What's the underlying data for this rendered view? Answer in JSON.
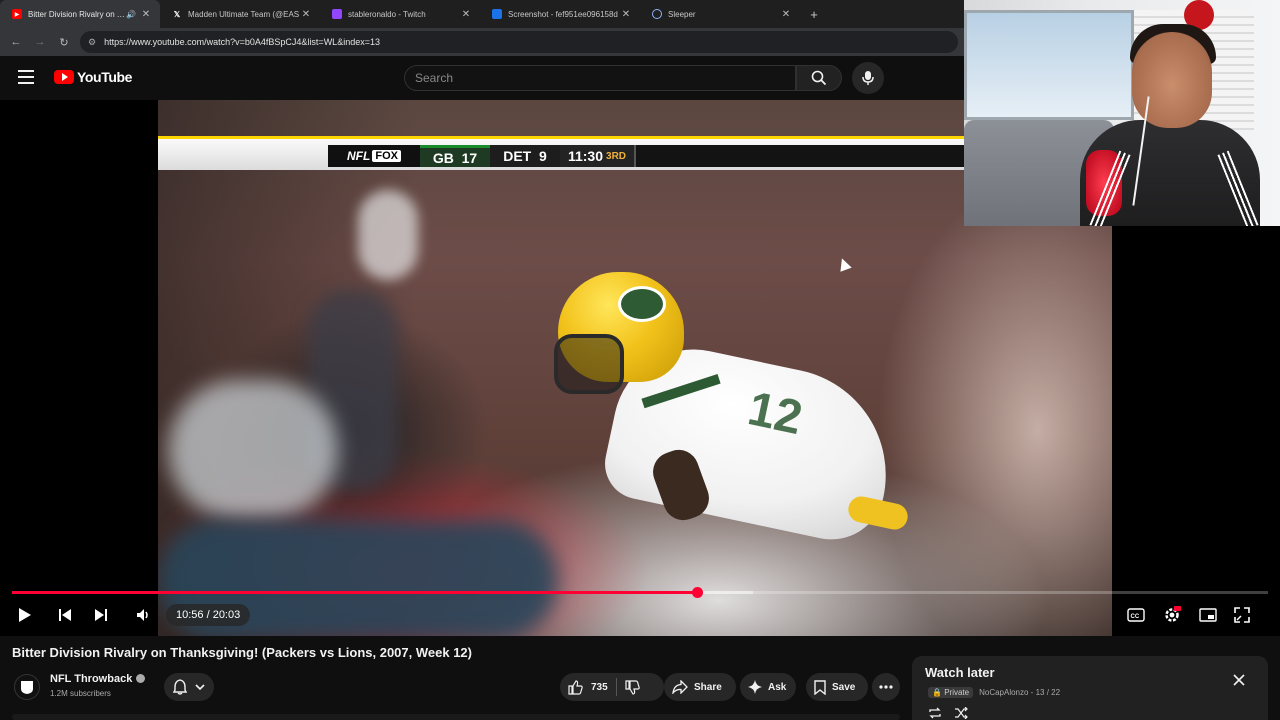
{
  "browser": {
    "tabs": [
      {
        "title": "Bitter Division Rivalry on Th",
        "active": true,
        "favicon": "youtube-icon",
        "audio": true
      },
      {
        "title": "Madden Ultimate Team (@EAS",
        "active": false,
        "favicon": "x-icon"
      },
      {
        "title": "stableronaldo - Twitch",
        "active": false,
        "favicon": "twitch-icon"
      },
      {
        "title": "Screenshot - fef951ee096158d",
        "active": false,
        "favicon": "screenshot-icon"
      },
      {
        "title": "Sleeper",
        "active": false,
        "favicon": "sleeper-icon"
      }
    ],
    "url": "https://www.youtube.com/watch?v=b0A4fBSpCJ4&list=WL&index=13"
  },
  "youtube": {
    "logo_text": "YouTube",
    "search_placeholder": "Search"
  },
  "scorebug": {
    "network_left": "NFL",
    "network_right": "FOX",
    "home_team": "GB",
    "home_score": "17",
    "away_team": "DET",
    "away_score": "9",
    "clock": "11:30",
    "quarter": "3RD"
  },
  "player": {
    "time_display": "10:56 / 20:03",
    "progress_fraction": 0.5454,
    "loaded_fraction": 0.59,
    "accent_color": "#ff0033"
  },
  "video": {
    "title": "Bitter Division Rivalry on Thanksgiving! (Packers vs Lions, 2007, Week 12)",
    "channel_name": "NFL Throwback",
    "subscribers": "1.2M subscribers",
    "likes": "735",
    "share_label": "Share",
    "ask_label": "Ask",
    "save_label": "Save"
  },
  "watch_later": {
    "title": "Watch later",
    "privacy": "Private",
    "owner_index": "NoCapAlonzo - 13 / 22"
  }
}
